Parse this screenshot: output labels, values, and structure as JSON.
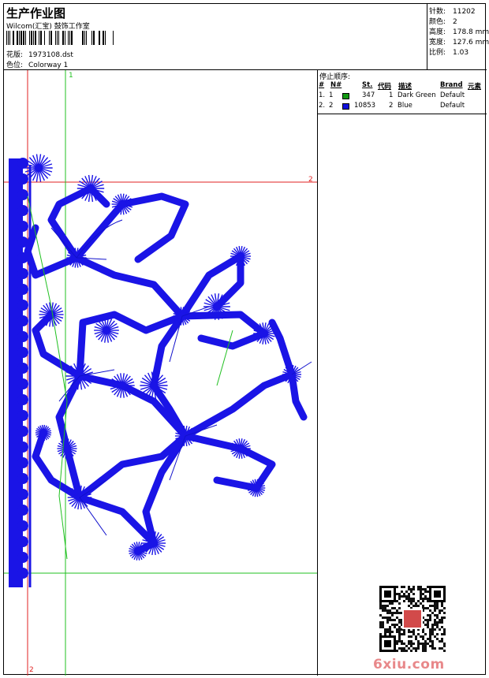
{
  "header": {
    "title": "生产作业图",
    "subtitle": "Wilcom(汇宝) 鼓饰工作室",
    "pattern_label": "花版:",
    "pattern_value": "1973108.dst",
    "colorway_label": "色位:",
    "colorway_value": "Colorway 1"
  },
  "stats": [
    {
      "label": "针数:",
      "value": "11202"
    },
    {
      "label": "颜色:",
      "value": "2"
    },
    {
      "label": "高度:",
      "value": "178.8 mm"
    },
    {
      "label": "宽度:",
      "value": "127.6 mm"
    },
    {
      "label": "比例:",
      "value": "1.03"
    }
  ],
  "stop_sequence": {
    "heading": "停止顺序:",
    "columns": [
      "#",
      "N#",
      "St.",
      "代码",
      "描述",
      "Brand",
      "元素"
    ],
    "rows": [
      {
        "idx": "1.",
        "n": "1",
        "color": "#119911",
        "st": "347",
        "code": "1",
        "desc": "Dark Green",
        "brand": "Default"
      },
      {
        "idx": "2.",
        "n": "2",
        "color": "#1111dd",
        "st": "10853",
        "code": "2",
        "desc": "Blue",
        "brand": "Default"
      }
    ]
  },
  "guides": {
    "top_green": "1",
    "right_red": "2",
    "bottom_red": "2"
  },
  "colors": {
    "stitch_blue": "#1a14e6",
    "thread_blue": "#1111cc",
    "guide_red": "#e02020",
    "guide_green": "#20c020"
  },
  "watermark": "6xiu.com"
}
